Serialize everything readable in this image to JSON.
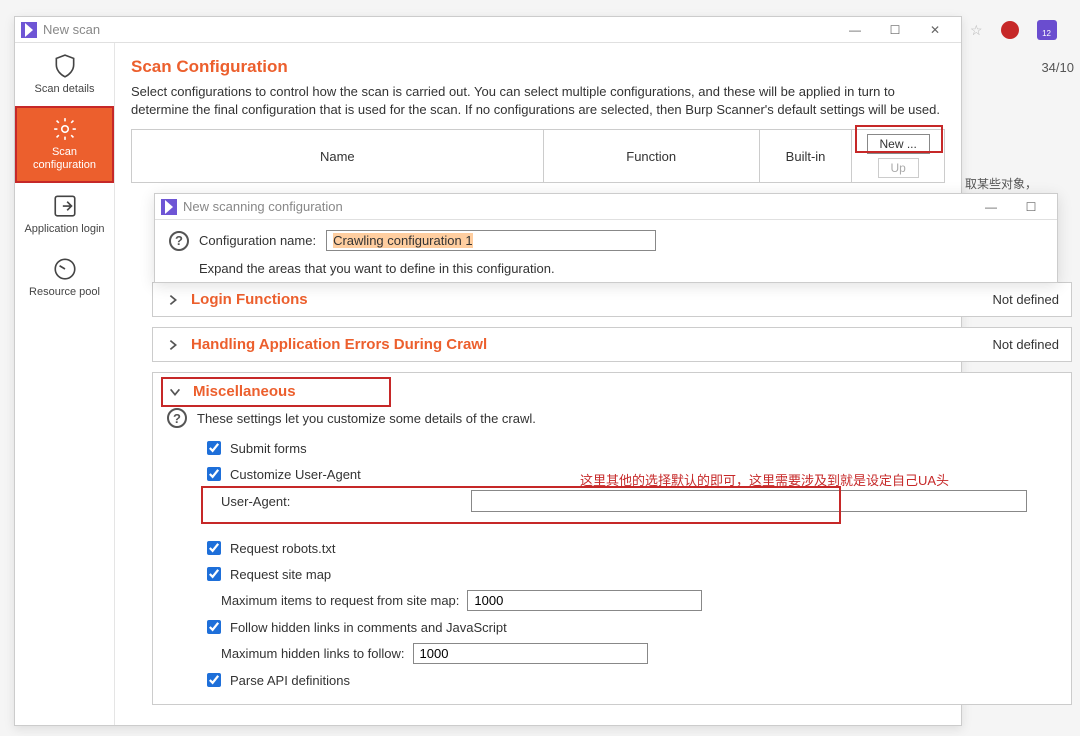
{
  "browser": {
    "counter": "34/10",
    "ext_badge": "12"
  },
  "window": {
    "title": "New scan",
    "min": "—",
    "max": "☐",
    "close": "✕"
  },
  "sidebar": {
    "items": [
      {
        "label": "Scan details"
      },
      {
        "label": "Scan configuration"
      },
      {
        "label": "Application login"
      },
      {
        "label": "Resource pool"
      }
    ]
  },
  "page": {
    "title": "Scan Configuration",
    "desc": "Select configurations to control how the scan is carried out. You can select multiple configurations, and these will be applied in turn to determine the final configuration that is used for the scan. If no configurations are selected, then Burp Scanner's default settings will be used."
  },
  "table": {
    "cols": {
      "name": "Name",
      "function": "Function",
      "builtin": "Built-in"
    },
    "new_btn": "New ...",
    "up_btn": "Up"
  },
  "inner": {
    "title": "New scanning configuration",
    "name_label": "Configuration name:",
    "name_value": "Crawling configuration 1",
    "expand": "Expand the areas that you want to define in this configuration.",
    "min": "—",
    "max": "☐"
  },
  "sections": {
    "login": {
      "title": "Login Functions",
      "status": "Not defined"
    },
    "errors": {
      "title": "Handling Application Errors During Crawl",
      "status": "Not defined"
    },
    "misc": {
      "title": "Miscellaneous",
      "desc": "These settings let you customize some details of the crawl.",
      "submit_forms": "Submit forms",
      "custom_ua": "Customize User-Agent",
      "ua_label": "User-Agent:",
      "ua_value": "",
      "robots": "Request robots.txt",
      "sitemap": "Request site map",
      "sitemap_max_label": "Maximum items to request from site map:",
      "sitemap_max_value": "1000",
      "hidden": "Follow hidden links in comments and JavaScript",
      "hidden_max_label": "Maximum hidden links to follow:",
      "hidden_max_value": "1000",
      "parse_api": "Parse API definitions"
    }
  },
  "annot": {
    "main": "这里其他的选择默认的即可，这里需要涉及到就是设定自己UA头",
    "right": "取某些对象，"
  }
}
